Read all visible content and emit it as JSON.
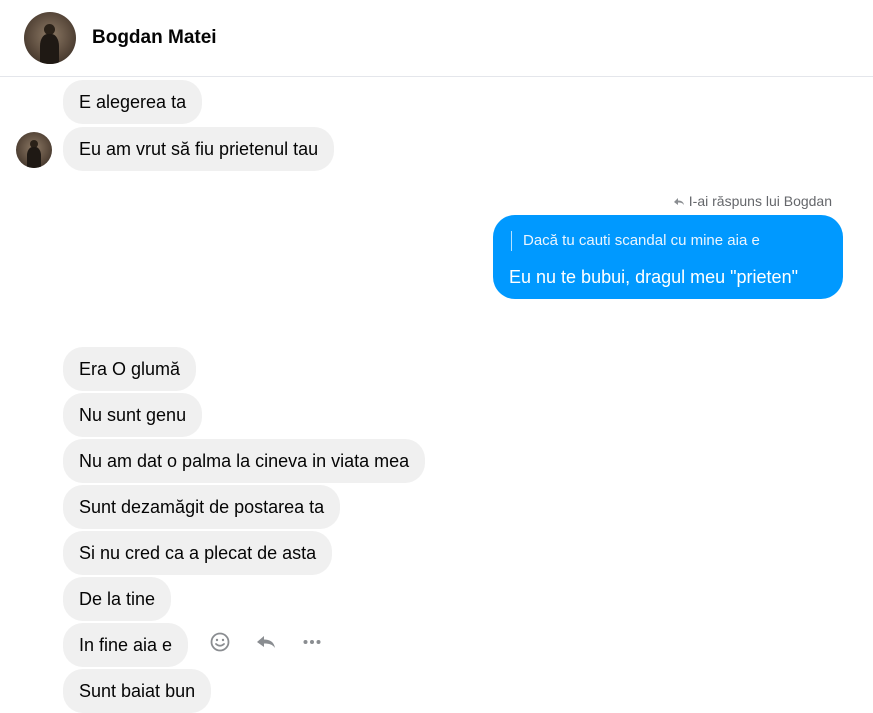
{
  "header": {
    "contact_name": "Bogdan Matei",
    "avatar_icon": "profile-photo"
  },
  "messages_top": [
    "E alegerea ta",
    "Eu am vrut să fiu prietenul tau"
  ],
  "reply": {
    "note": "I-ai răspuns lui Bogdan",
    "quoted_text": "Dacă tu cauti scandal cu mine aia e",
    "text": "Eu nu te bubui, dragul meu \"prieten\"",
    "bubble_color": "#0099ff"
  },
  "messages_bottom": [
    "Era O glumă",
    "Nu sunt genu",
    "Nu am dat o palma la cineva in viata mea",
    "Sunt dezamăgit de postarea ta",
    "Si nu cred ca a plecat de asta",
    "De la tine",
    "In fine aia e",
    "Sunt baiat bun"
  ],
  "message_actions": [
    "emoji-icon",
    "reply-icon",
    "more-icon"
  ],
  "colors": {
    "received_bubble": "#f0f0f0",
    "sent_bubble": "#0099ff",
    "icon_gray": "#8a8d91"
  }
}
